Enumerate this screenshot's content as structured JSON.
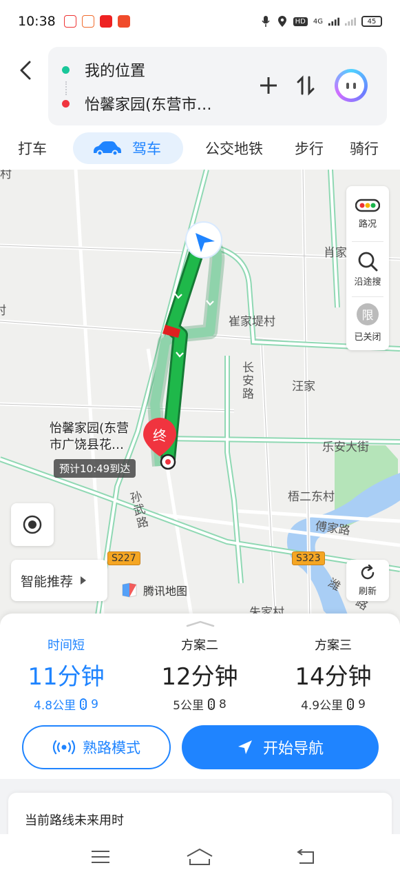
{
  "status_bar": {
    "time": "10:38",
    "network": "4G",
    "hd": "HD",
    "battery": "45"
  },
  "header": {
    "origin": "我的位置",
    "destination": "怡馨家园(东营市…"
  },
  "modes": [
    {
      "label": "打车"
    },
    {
      "label": "驾车",
      "active": true
    },
    {
      "label": "公交地铁"
    },
    {
      "label": "步行"
    },
    {
      "label": "骑行"
    }
  ],
  "map": {
    "tools": {
      "traffic": "路况",
      "search_along": "沿途搜",
      "limit_icon": "限",
      "limit_status": "已关闭"
    },
    "labels": {
      "xiaojia": "肖家",
      "cuijiadi": "崔家堤村",
      "wangjia": "汪家",
      "changan": "长安路",
      "lean": "乐安大街",
      "wuer": "梧二东村",
      "fujia": "傅家路",
      "sunwu": "孙武路",
      "zhujia": "朱家村",
      "wei": "潍",
      "road_cut": "路",
      "left_cut1": "村",
      "left_cut2": "村"
    },
    "shields": {
      "s227": "S227",
      "s323": "S323"
    },
    "dest_label_line1": "怡馨家园(东营",
    "dest_label_line2": "市广饶县花…",
    "end_marker": "终",
    "eta": "预计10:49到达",
    "smart_recommend": "智能推荐",
    "refresh": "刷新",
    "brand": "腾讯地图"
  },
  "plans": [
    {
      "title": "时间短",
      "time": "11分钟",
      "distance": "4.8公里",
      "lights": "9",
      "active": true
    },
    {
      "title": "方案二",
      "time": "12分钟",
      "distance": "5公里",
      "lights": "8"
    },
    {
      "title": "方案三",
      "time": "14分钟",
      "distance": "4.9公里",
      "lights": "9"
    }
  ],
  "buttons": {
    "familiar": "熟路模式",
    "start": "开始导航"
  },
  "future_time": "当前路线未来用时",
  "colors": {
    "accent": "#1f84ff",
    "route_green": "#1fb84a",
    "route_alt": "#8fd3ab",
    "congestion": "#e02020"
  }
}
